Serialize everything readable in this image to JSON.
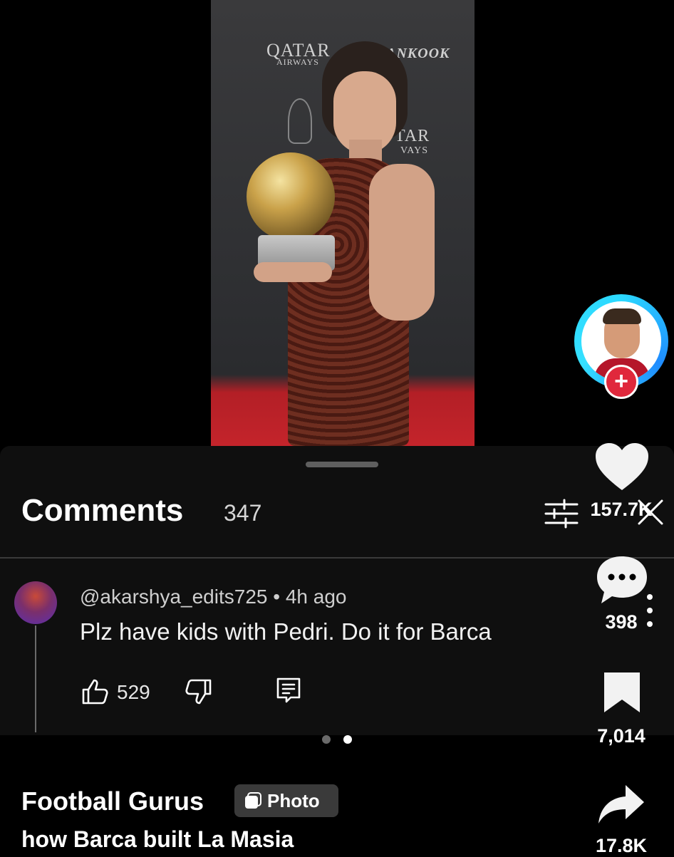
{
  "photo": {
    "brand_top": "QATAR",
    "brand_sub": "AIRWAYS",
    "brand_right": "ANKOOK",
    "brand_mid": "TAR",
    "brand_mid_sub": "VAYS"
  },
  "comments_sheet": {
    "title": "Comments",
    "count": "347"
  },
  "comment": {
    "username_time": "@akarshya_edits725 • 4h ago",
    "text": "Plz have kids with Pedri. Do it for Barca",
    "likes": "529"
  },
  "rail": {
    "follow_label": "+",
    "likes": "157.7K",
    "comments": "398",
    "saves": "7,014",
    "shares": "17.8K"
  },
  "pager": {
    "total": 2,
    "active_index": 1
  },
  "footer": {
    "author": "Football Gurus",
    "badge": "Photo",
    "caption": "how Barca built La Masia"
  },
  "colors": {
    "background": "#000000",
    "sheet": "#0f0f0f",
    "follow_red": "#e0283c",
    "ring_blue": "#2bd9ff"
  }
}
